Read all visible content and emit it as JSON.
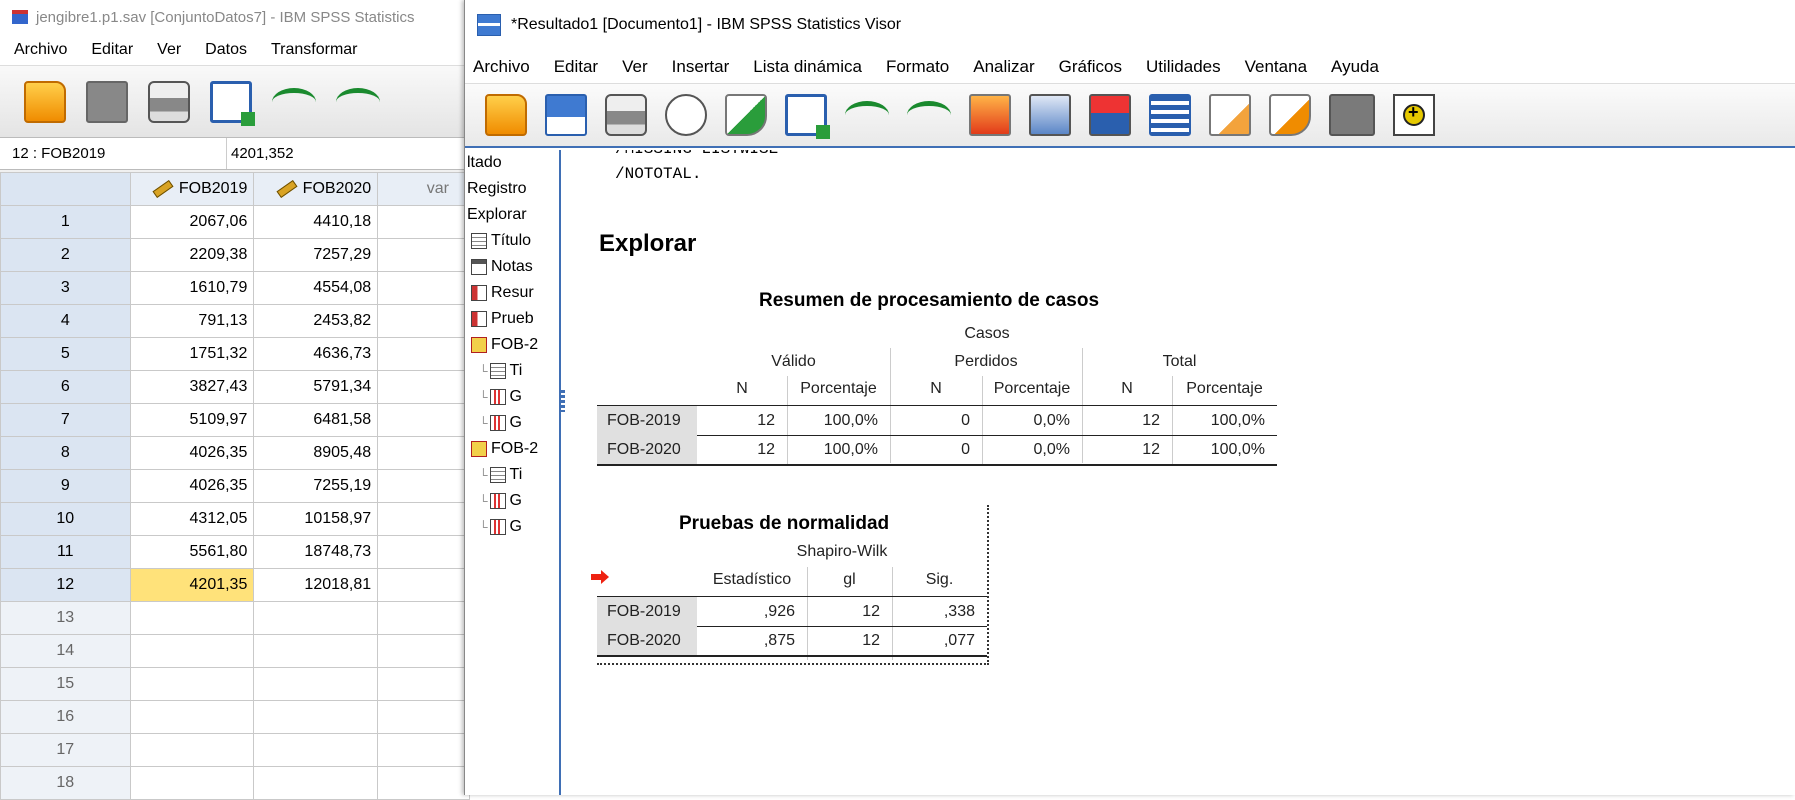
{
  "editor": {
    "title": "jengibre1.p1.sav [ConjuntoDatos7] - IBM SPSS Statistics",
    "menu": [
      "Archivo",
      "Editar",
      "Ver",
      "Datos",
      "Transformar"
    ],
    "cell_name": "12 : FOB2019",
    "cell_value": "4201,352",
    "columns": [
      "FOB2019",
      "FOB2020",
      "var"
    ],
    "rows": [
      {
        "n": "1",
        "a": "2067,06",
        "b": "4410,18"
      },
      {
        "n": "2",
        "a": "2209,38",
        "b": "7257,29"
      },
      {
        "n": "3",
        "a": "1610,79",
        "b": "4554,08"
      },
      {
        "n": "4",
        "a": "791,13",
        "b": "2453,82"
      },
      {
        "n": "5",
        "a": "1751,32",
        "b": "4636,73"
      },
      {
        "n": "6",
        "a": "3827,43",
        "b": "5791,34"
      },
      {
        "n": "7",
        "a": "5109,97",
        "b": "6481,58"
      },
      {
        "n": "8",
        "a": "4026,35",
        "b": "8905,48"
      },
      {
        "n": "9",
        "a": "4026,35",
        "b": "7255,19"
      },
      {
        "n": "10",
        "a": "4312,05",
        "b": "10158,97"
      },
      {
        "n": "11",
        "a": "5561,80",
        "b": "18748,73"
      },
      {
        "n": "12",
        "a": "4201,35",
        "b": "12018,81"
      }
    ],
    "empty_rows": [
      "13",
      "14",
      "15",
      "16",
      "17",
      "18"
    ]
  },
  "viewer": {
    "title": "*Resultado1 [Documento1] - IBM SPSS Statistics Visor",
    "menu": [
      "Archivo",
      "Editar",
      "Ver",
      "Insertar",
      "Lista dinámica",
      "Formato",
      "Analizar",
      "Gráficos",
      "Utilidades",
      "Ventana",
      "Ayuda"
    ],
    "outline": [
      {
        "label": "ltado",
        "icon": "none",
        "indent": 0
      },
      {
        "label": "Registro",
        "icon": "none",
        "indent": 0
      },
      {
        "label": "Explorar",
        "icon": "none",
        "indent": 0
      },
      {
        "label": "Título",
        "icon": "doc",
        "indent": 1
      },
      {
        "label": "Notas",
        "icon": "note",
        "indent": 1
      },
      {
        "label": "Resur",
        "icon": "table",
        "indent": 1
      },
      {
        "label": "Prueb",
        "icon": "table",
        "indent": 1
      },
      {
        "label": "FOB-2",
        "icon": "folder",
        "indent": 1
      },
      {
        "label": "Ti",
        "icon": "doc",
        "indent": 2
      },
      {
        "label": "G",
        "icon": "graph",
        "indent": 2
      },
      {
        "label": "G",
        "icon": "graph",
        "indent": 2
      },
      {
        "label": "FOB-2",
        "icon": "folder",
        "indent": 1
      },
      {
        "label": "Ti",
        "icon": "doc",
        "indent": 2
      },
      {
        "label": "G",
        "icon": "graph",
        "indent": 2
      },
      {
        "label": "G",
        "icon": "graph",
        "indent": 2
      }
    ],
    "syntax": [
      "/MISSING LISTWISE",
      "/NOTOTAL."
    ],
    "heading": "Explorar",
    "case_summary": {
      "title": "Resumen de procesamiento de casos",
      "group": "Casos",
      "subgroups": [
        "Válido",
        "Perdidos",
        "Total"
      ],
      "cols": [
        "N",
        "Porcentaje",
        "N",
        "Porcentaje",
        "N",
        "Porcentaje"
      ],
      "rows": [
        {
          "label": "FOB-2019",
          "vals": [
            "12",
            "100,0%",
            "0",
            "0,0%",
            "12",
            "100,0%"
          ]
        },
        {
          "label": "FOB-2020",
          "vals": [
            "12",
            "100,0%",
            "0",
            "0,0%",
            "12",
            "100,0%"
          ]
        }
      ]
    },
    "normality": {
      "title": "Pruebas de normalidad",
      "group": "Shapiro-Wilk",
      "cols": [
        "Estadístico",
        "gl",
        "Sig."
      ],
      "rows": [
        {
          "label": "FOB-2019",
          "vals": [
            ",926",
            "12",
            ",338"
          ]
        },
        {
          "label": "FOB-2020",
          "vals": [
            ",875",
            "12",
            ",077"
          ]
        }
      ]
    }
  }
}
